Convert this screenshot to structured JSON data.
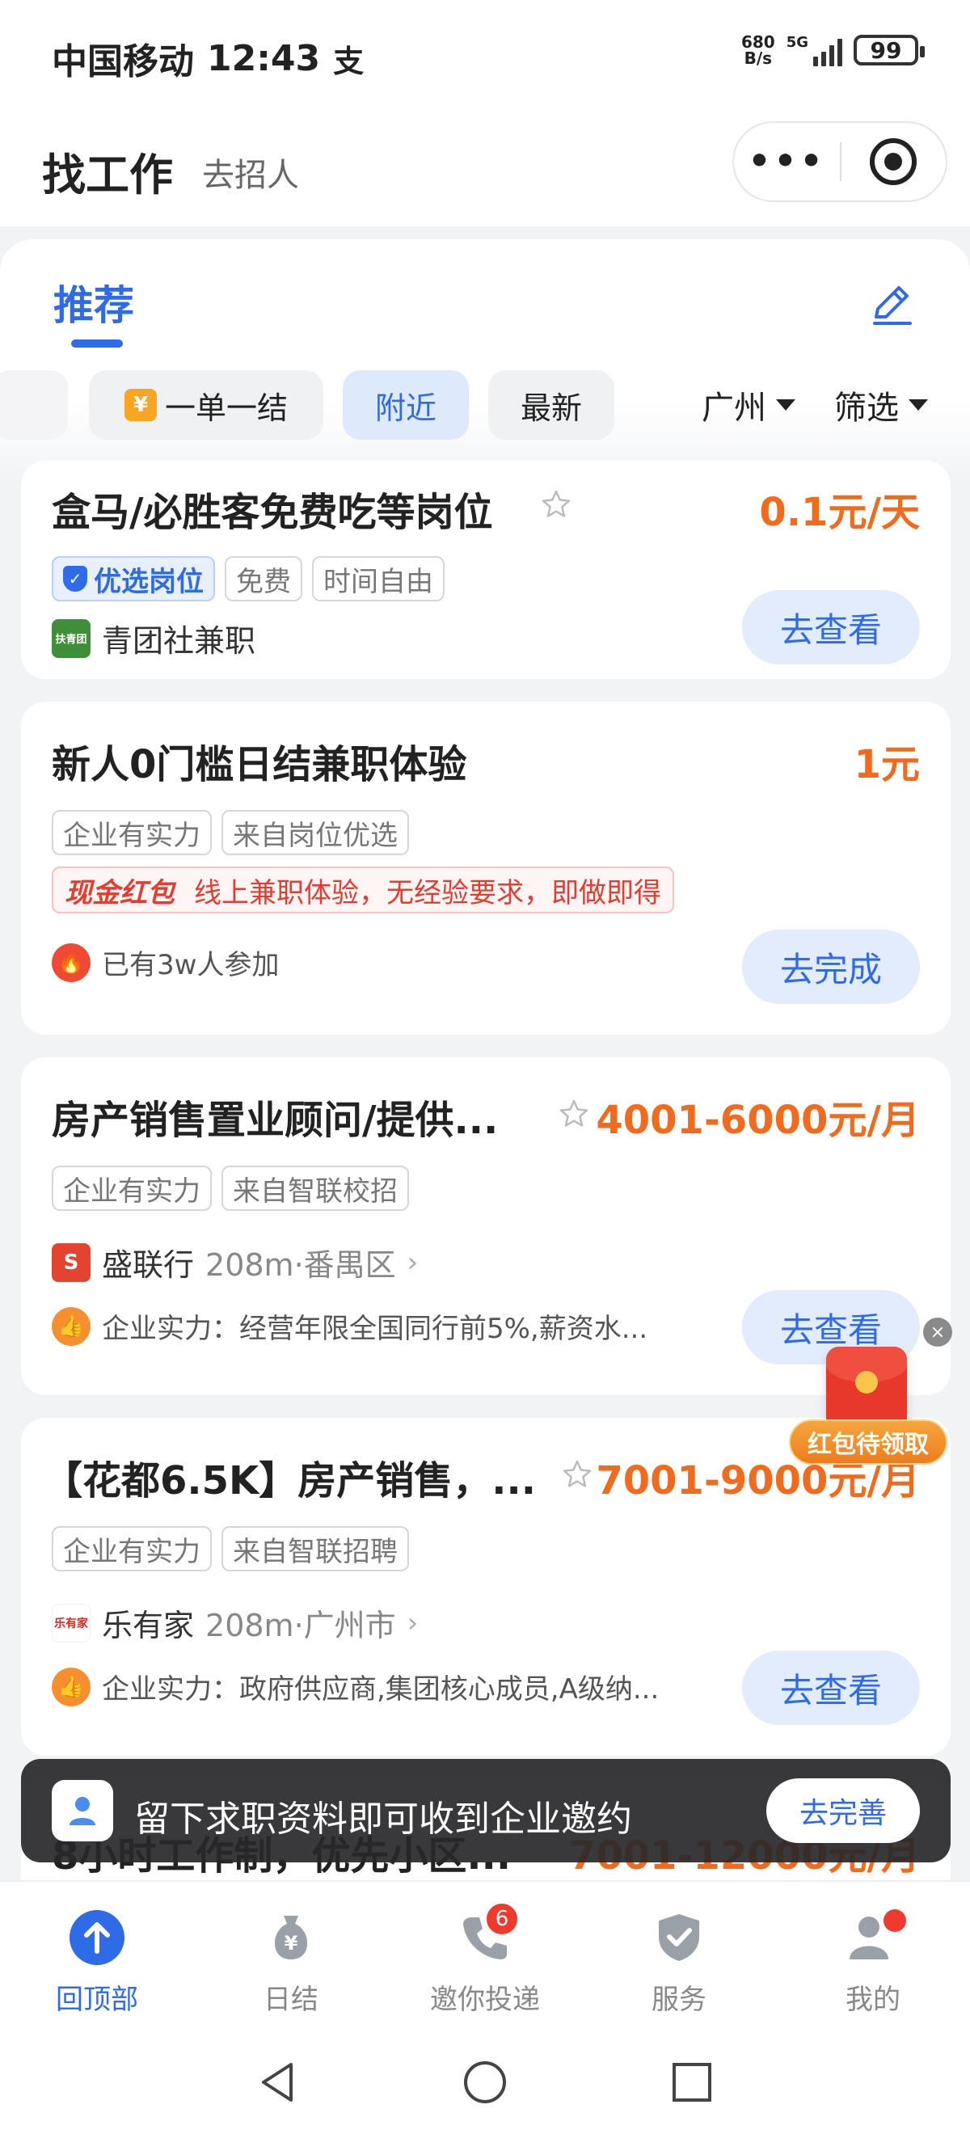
{
  "status_bar": {
    "carrier": "中国移动",
    "time": "12:43",
    "pay_glyph": "支",
    "net_speed_value": "680",
    "net_speed_unit": "B/s",
    "network": "5G",
    "battery": "99"
  },
  "nav": {
    "title": "找工作",
    "subtitle": "去招人",
    "more_glyph": "•••"
  },
  "panel": {
    "tab_label": "推荐",
    "filters": {
      "chips": [
        "一单一结",
        "附近",
        "最新"
      ],
      "yen_glyph": "¥",
      "active": "附近",
      "city": "广州",
      "filter_label": "筛选"
    }
  },
  "jobs": [
    {
      "title": "盒马/必胜客免费吃等岗位",
      "salary": "0.1元/天",
      "premium_tag": "优选岗位",
      "tags": [
        "免费",
        "时间自由"
      ],
      "company": "青团社兼职",
      "company_logo_text": "扶青团",
      "button": "去查看"
    },
    {
      "title": "新人0门槛日结兼职体验",
      "salary": "1元",
      "tags": [
        "企业有实力",
        "来自岗位优选"
      ],
      "bonus_label": "现金红包",
      "bonus_text": "线上兼职体验，无经验要求，即做即得",
      "feature": "已有3w人参加",
      "button": "去完成"
    },
    {
      "title": "房产销售置业顾问/提供...",
      "salary": "4001-6000元/月",
      "tags": [
        "企业有实力",
        "来自智联校招"
      ],
      "company": "盛联行",
      "distance": "208m·番禺区",
      "company_logo_text": "S",
      "feature": "企业实力：经营年限全国同行前5%,薪资水...",
      "button": "去查看"
    },
    {
      "title": "【花都6.5K】房产销售，...",
      "salary": "7001-9000元/月",
      "tags": [
        "企业有实力",
        "来自智联招聘"
      ],
      "company": "乐有家",
      "distance": "208m·广州市",
      "company_logo_text": "乐有家",
      "feature": "企业实力：政府供应商,集团核心成员,A级纳...",
      "button": "去查看"
    },
    {
      "title": "8小时工作制，优先小区...",
      "salary": "7001-12000元/月"
    }
  ],
  "red_envelope": {
    "label": "红包待领取",
    "close_glyph": "×"
  },
  "toast": {
    "text": "留下求职资料即可收到企业邀约",
    "button": "去完善"
  },
  "tabbar": {
    "items": [
      {
        "label": "回顶部",
        "icon": "arrow-up-icon"
      },
      {
        "label": "日结",
        "icon": "money-bag-icon"
      },
      {
        "label": "邀你投递",
        "icon": "phone-icon",
        "badge": "6"
      },
      {
        "label": "服务",
        "icon": "shield-check-icon"
      },
      {
        "label": "我的",
        "icon": "user-icon"
      }
    ],
    "yen_glyph": "¥"
  },
  "colors": {
    "accent": "#2f6be6",
    "salary": "#f06b1d",
    "badge": "#ef3b2d"
  }
}
